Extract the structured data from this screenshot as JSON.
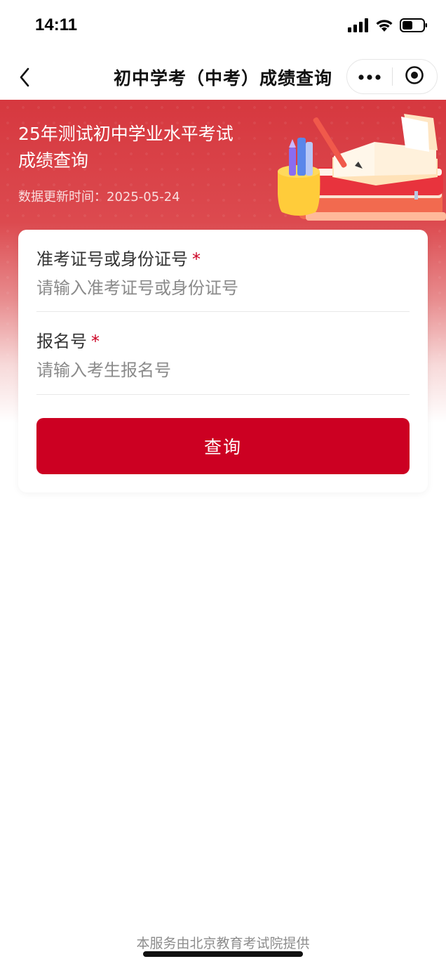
{
  "status_bar": {
    "time": "14:11",
    "icons": [
      "cellular-signal-icon",
      "wifi-icon",
      "battery-icon"
    ]
  },
  "nav": {
    "title": "初中学考（中考）成绩查询",
    "back_icon": "chevron-left-icon",
    "more_icon": "more-dots-icon",
    "close_icon": "target-circle-icon"
  },
  "hero": {
    "title": "25年测试初中学业水平考试\n成绩查询",
    "update_label": "数据更新时间：",
    "update_date": "2025-05-24",
    "illustration": "books-and-pencil-cup-illustration"
  },
  "form": {
    "fields": [
      {
        "label": "准考证号或身份证号",
        "required_mark": "*",
        "placeholder": "请输入准考证号或身份证号",
        "value": ""
      },
      {
        "label": "报名号",
        "required_mark": "*",
        "placeholder": "请输入考生报名号",
        "value": ""
      }
    ],
    "submit_label": "查询"
  },
  "footer": {
    "text": "本服务由北京教育考试院提供"
  },
  "colors": {
    "accent": "#cc0022",
    "hero_red": "#d6383f",
    "placeholder": "#8a8a8a"
  }
}
